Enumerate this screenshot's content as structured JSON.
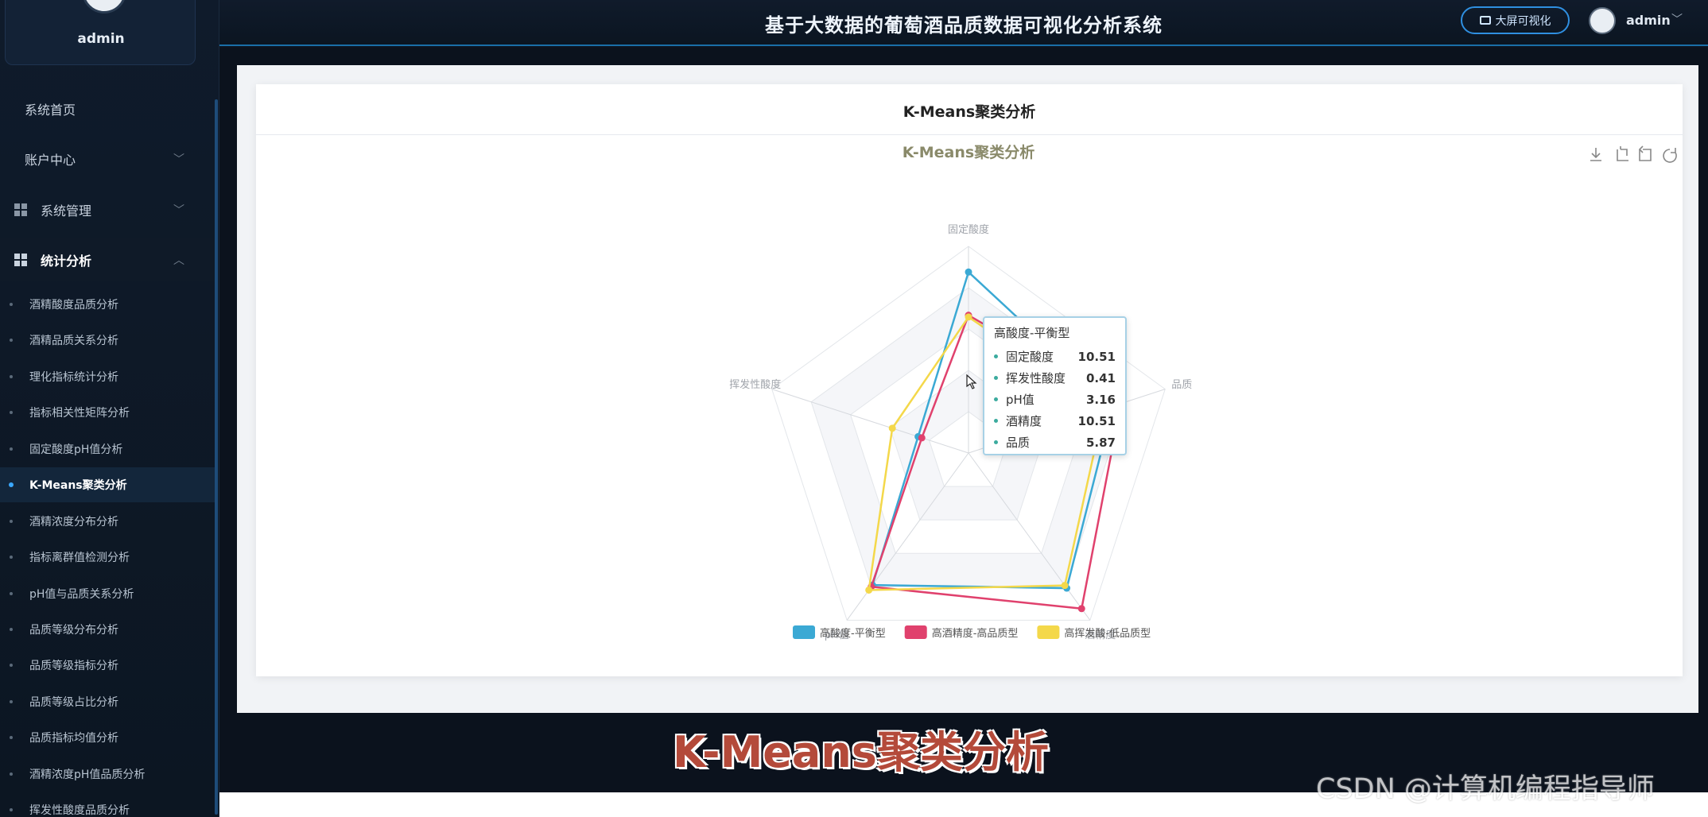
{
  "user": {
    "name": "admin"
  },
  "header": {
    "title": "基于大数据的葡萄酒品质数据可视化分析系统",
    "big_screen_label": "大屏可视化",
    "user_name": "admin"
  },
  "sidebar": {
    "top_items": [
      {
        "label": "系统首页"
      },
      {
        "label": "账户中心"
      },
      {
        "label": "系统管理"
      },
      {
        "label": "统计分析"
      }
    ],
    "sub_items": [
      "酒精酸度品质分析",
      "酒精品质关系分析",
      "理化指标统计分析",
      "指标相关性矩阵分析",
      "固定酸度pH值分析",
      "K-Means聚类分析",
      "酒精浓度分布分析",
      "指标离群值检测分析",
      "pH值与品质关系分析",
      "品质等级分布分析",
      "品质等级指标分析",
      "品质等级占比分析",
      "品质指标均值分析",
      "酒精浓度pH值品质分析",
      "挥发性酸度品质分析"
    ],
    "active_sub": "K-Means聚类分析"
  },
  "card": {
    "title": "K-Means聚类分析"
  },
  "chart_data": {
    "type": "radar",
    "title": "K-Means聚类分析",
    "indicators": [
      "固定酸度",
      "品质",
      "酒精度",
      "pH值",
      "挥发性酸度"
    ],
    "series": [
      {
        "name": "高酸度-平衡型",
        "color": "#3ba9d4",
        "values": [
          10.51,
          5.87,
          10.51,
          3.16,
          0.41
        ]
      },
      {
        "name": "高酒精度-高品质型",
        "color": "#e0416d",
        "values": [
          8.0,
          6.2,
          12.1,
          3.2,
          0.38
        ]
      },
      {
        "name": "高挥发酸-低品质型",
        "color": "#f4d84a",
        "values": [
          7.9,
          5.5,
          10.3,
          3.28,
          0.62
        ]
      }
    ],
    "max": [
      12,
      8,
      13,
      4,
      1.6
    ],
    "legend_position": "bottom"
  },
  "tooltip": {
    "title": "高酸度-平衡型",
    "rows": [
      {
        "name": "固定酸度",
        "value": "10.51"
      },
      {
        "name": "挥发性酸度",
        "value": "0.41"
      },
      {
        "name": "pH值",
        "value": "3.16"
      },
      {
        "name": "酒精度",
        "value": "10.51"
      },
      {
        "name": "品质",
        "value": "5.87"
      }
    ]
  },
  "overlay": {
    "title": "K-Means聚类分析",
    "watermark": "CSDN @计算机编程指导师"
  }
}
